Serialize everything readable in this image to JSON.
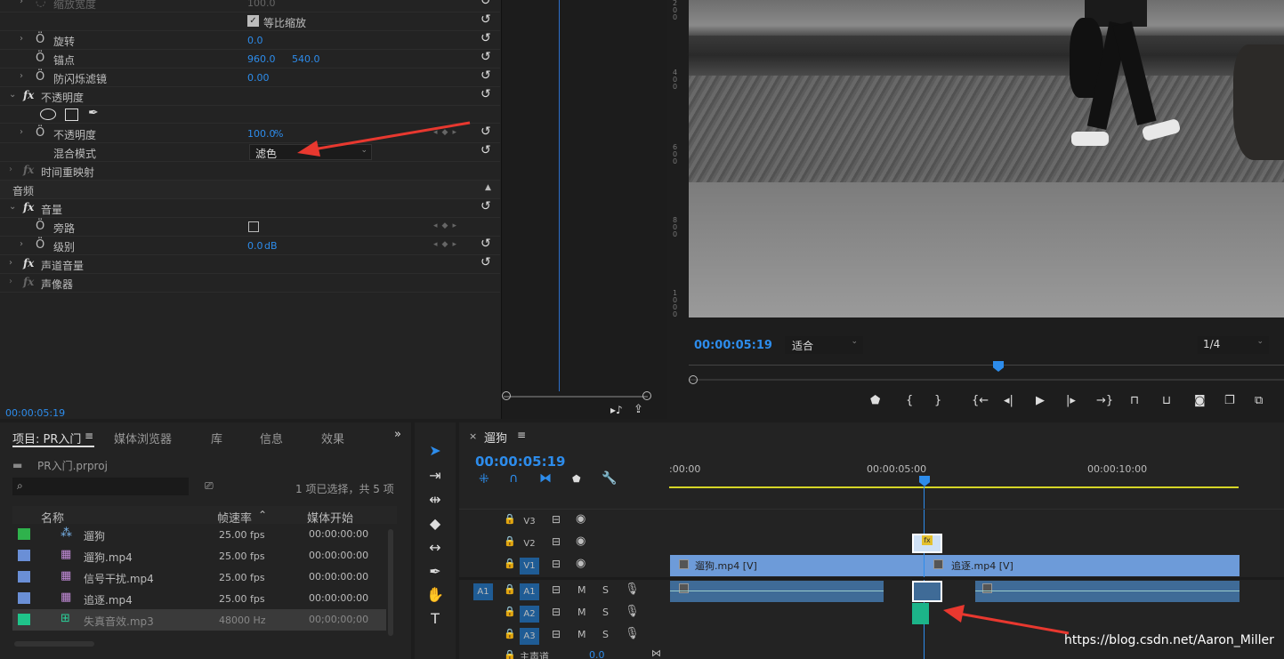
{
  "effect_controls": {
    "rows": [
      {
        "name": "scale-width",
        "label": "缩放宽度",
        "value": "100.0",
        "dim": true
      },
      {
        "name": "uniform-scale",
        "label": "等比缩放",
        "checked": true
      },
      {
        "name": "rotation",
        "label": "旋转",
        "value": "0.0"
      },
      {
        "name": "anchor",
        "label": "锚点",
        "value": "960.0",
        "value2": "540.0"
      },
      {
        "name": "anti-flicker",
        "label": "防闪烁滤镜",
        "value": "0.00"
      },
      {
        "name": "opacity-group",
        "label": "不透明度"
      },
      {
        "name": "opacity",
        "label": "不透明度",
        "value": "100.0",
        "unit": "%"
      },
      {
        "name": "blend-mode",
        "label": "混合模式",
        "value": "滤色"
      },
      {
        "name": "time-remap",
        "label": "时间重映射"
      },
      {
        "name": "audio-section",
        "label": "音频"
      },
      {
        "name": "volume-group",
        "label": "音量"
      },
      {
        "name": "bypass",
        "label": "旁路"
      },
      {
        "name": "level",
        "label": "级别",
        "value": "0.0",
        "unit": "dB"
      },
      {
        "name": "channel-volume",
        "label": "声道音量"
      },
      {
        "name": "panner",
        "label": "声像器"
      }
    ],
    "timecode": "00:00:05:19"
  },
  "program_monitor": {
    "timecode": "00:00:05:19",
    "fit": "适合",
    "resolution": "1/4",
    "ruler_marks": [
      "2\n0\n0",
      "4\n0\n0",
      "6\n0\n0",
      "8\n0\n0",
      "1\n0\n0\n0"
    ]
  },
  "project": {
    "tabs": [
      "项目: PR入门",
      "媒体浏览器",
      "库",
      "信息",
      "效果"
    ],
    "file": "PR入门.prproj",
    "status": "1 项已选择，共 5 项",
    "col_name": "名称",
    "col_fps": "帧速率",
    "col_start": "媒体开始",
    "items": [
      {
        "name": "遛狗",
        "fps": "25.00 fps",
        "start": "00:00:00:00",
        "color": "#2fb24c",
        "icon": "sequence"
      },
      {
        "name": "遛狗.mp4",
        "fps": "25.00 fps",
        "start": "00:00:00:00",
        "color": "#6a8fd6",
        "icon": "video"
      },
      {
        "name": "信号干扰.mp4",
        "fps": "25.00 fps",
        "start": "00:00:00:00",
        "color": "#6a8fd6",
        "icon": "video"
      },
      {
        "name": "追逐.mp4",
        "fps": "25.00 fps",
        "start": "00:00:00:00",
        "color": "#6a8fd6",
        "icon": "video"
      },
      {
        "name": "失真音效.mp3",
        "fps": "48000 Hz",
        "start": "00;00;00;00",
        "color": "#1fc48a",
        "icon": "audio"
      }
    ]
  },
  "timeline": {
    "sequence": "遛狗",
    "timecode": "00:00:05:19",
    "ruler": [
      ":00:00",
      "00:00:05:00",
      "00:00:10:00"
    ],
    "video_tracks": [
      "V3",
      "V2",
      "V1"
    ],
    "audio_tracks": [
      "A1",
      "A2",
      "A3"
    ],
    "source_patch": "A1",
    "master": "主声道",
    "master_value": "0.0",
    "clips": {
      "v1a": "遛狗.mp4 [V]",
      "v1b": "追逐.mp4 [V]"
    },
    "mute": "M",
    "solo": "S"
  },
  "watermark": "https://blog.csdn.net/Aaron_Miller"
}
